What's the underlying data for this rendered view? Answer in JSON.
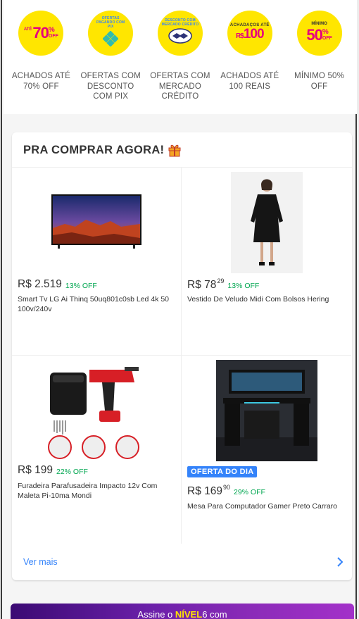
{
  "categories": [
    {
      "label": "Achados até 70% off",
      "badge": {
        "prefix": "ATÉ",
        "number": "70",
        "pct": "%",
        "off": "OFF"
      }
    },
    {
      "label": "Ofertas com desconto com Pix",
      "badge": {
        "tagline": "OFERTAS PAGANDO COM PIX"
      }
    },
    {
      "label": "Ofertas com Mercado Crédito",
      "badge": {
        "tagline": "DESCONTO COM MERCADO CRÉDITO"
      }
    },
    {
      "label": "Achados até 100 reais",
      "badge": {
        "prefix": "ACHADAÇOS ATÉ",
        "currency": "R$",
        "number": "100"
      }
    },
    {
      "label": "Mínimo 50% off",
      "badge": {
        "prefix": "MÍNIMO",
        "number": "50",
        "pct": "%",
        "off": "OFF"
      }
    }
  ],
  "section": {
    "title": "PRA COMPRAR AGORA!",
    "see_more": "Ver mais"
  },
  "products": [
    {
      "price": "R$ 2.519",
      "cents": "",
      "discount": "13% OFF",
      "name": "Smart Tv LG Ai Thinq 50uq801c0sb Led 4k 50 100v/240v",
      "badge": ""
    },
    {
      "price": "R$ 78",
      "cents": "29",
      "discount": "13% OFF",
      "name": "Vestido De Veludo Midi Com Bolsos Hering",
      "badge": ""
    },
    {
      "price": "R$ 199",
      "cents": "",
      "discount": "22% OFF",
      "name": "Furadeira Parafusadeira Impacto 12v Com Maleta Pi-10ma Mondi",
      "badge": ""
    },
    {
      "price": "R$ 169",
      "cents": "90",
      "discount": "29% OFF",
      "name": "Mesa Para Computador Gamer Preto Carraro",
      "badge": "OFERTA DO DIA"
    }
  ],
  "promo": {
    "prefix": "Assine o ",
    "brand": "NÍVEL",
    "suffix": "6 com"
  },
  "colors": {
    "accent_blue": "#3483fa",
    "discount_green": "#00a650",
    "badge_yellow": "#ffe600",
    "brand_pink": "#e6007e"
  },
  "icons": [
    "gift-icon",
    "chevron-right-icon",
    "pix-icon",
    "handshake-icon"
  ]
}
